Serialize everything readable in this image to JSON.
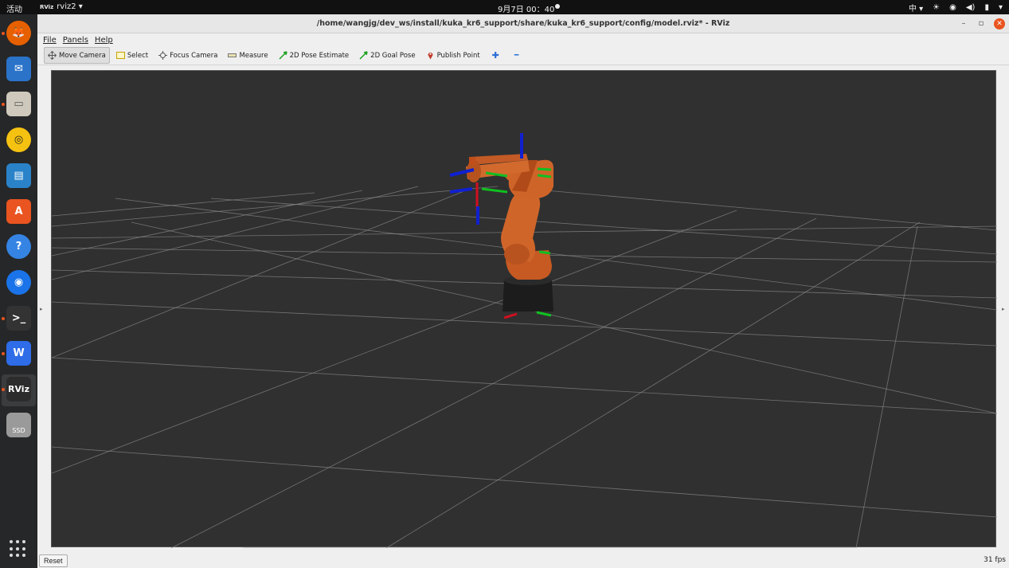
{
  "topbar": {
    "activities": "活动",
    "app_icon_text": "RViz",
    "app_name": "rviz2 ▾",
    "clock": "9月7日  00：40",
    "tray": {
      "input_method": "中 ▾",
      "brightness": "☀",
      "wifi": "◉",
      "volume": "◀)",
      "battery": "▮",
      "menu": "▾"
    }
  },
  "dock": {
    "items": [
      {
        "name": "firefox-icon",
        "color": "#e66000",
        "running": true
      },
      {
        "name": "thunderbird-icon",
        "color": "#2a73c9",
        "running": false
      },
      {
        "name": "files-icon",
        "color": "#cfc9bd",
        "running": true
      },
      {
        "name": "rhythmbox-icon",
        "color": "#f5c211",
        "running": false
      },
      {
        "name": "libreoffice-writer-icon",
        "color": "#2a83c9",
        "running": false
      },
      {
        "name": "software-center-icon",
        "color": "#e95420",
        "running": false
      },
      {
        "name": "help-icon",
        "color": "#3584e4",
        "running": false
      },
      {
        "name": "chrome-icon",
        "color": "#1a73e8",
        "running": false
      },
      {
        "name": "terminal-icon",
        "color": "#333333",
        "running": true
      },
      {
        "name": "wps-icon",
        "color": "#2e6ce8",
        "running": true
      },
      {
        "name": "rviz-icon",
        "color": "#2c2c2c",
        "running": true
      },
      {
        "name": "ssd-drive-icon",
        "color": "#9a9a9a",
        "running": false
      }
    ],
    "rviz_label": "RViz",
    "ssd_label": "SSD"
  },
  "window": {
    "title": "/home/wangjg/dev_ws/install/kuka_kr6_support/share/kuka_kr6_support/config/model.rviz* - RViz",
    "controls": {
      "minimize": "–",
      "maximize": "▫",
      "close": "✕"
    }
  },
  "menubar": {
    "items": [
      {
        "label": "File",
        "name": "menu-file"
      },
      {
        "label": "Panels",
        "name": "menu-panels"
      },
      {
        "label": "Help",
        "name": "menu-help"
      }
    ]
  },
  "toolbar": {
    "tools": [
      {
        "name": "tool-move-camera",
        "label": "Move Camera",
        "icon": "move-camera-icon",
        "active": true
      },
      {
        "name": "tool-select",
        "label": "Select",
        "icon": "select-icon",
        "active": false
      },
      {
        "name": "tool-focus-camera",
        "label": "Focus Camera",
        "icon": "focus-camera-icon",
        "active": false
      },
      {
        "name": "tool-measure",
        "label": "Measure",
        "icon": "measure-icon",
        "active": false
      },
      {
        "name": "tool-2d-pose-estimate",
        "label": "2D Pose Estimate",
        "icon": "pose-arrow-icon",
        "active": false
      },
      {
        "name": "tool-2d-goal-pose",
        "label": "2D Goal Pose",
        "icon": "goal-arrow-icon",
        "active": false
      },
      {
        "name": "tool-publish-point",
        "label": "Publish Point",
        "icon": "map-pin-icon",
        "active": false
      }
    ],
    "add_tool_symbol": "✚",
    "remove_tool_symbol": "━"
  },
  "viewport": {
    "background": "#303030",
    "grid_color": "#8a8a8a",
    "robot_color": "#d0652a",
    "base_color": "#1c1c1c",
    "axis_colors": {
      "x": "#d01020",
      "y": "#10c020",
      "z": "#1020d0"
    }
  },
  "statusbar": {
    "reset_label": "Reset",
    "fps": "31 fps"
  }
}
